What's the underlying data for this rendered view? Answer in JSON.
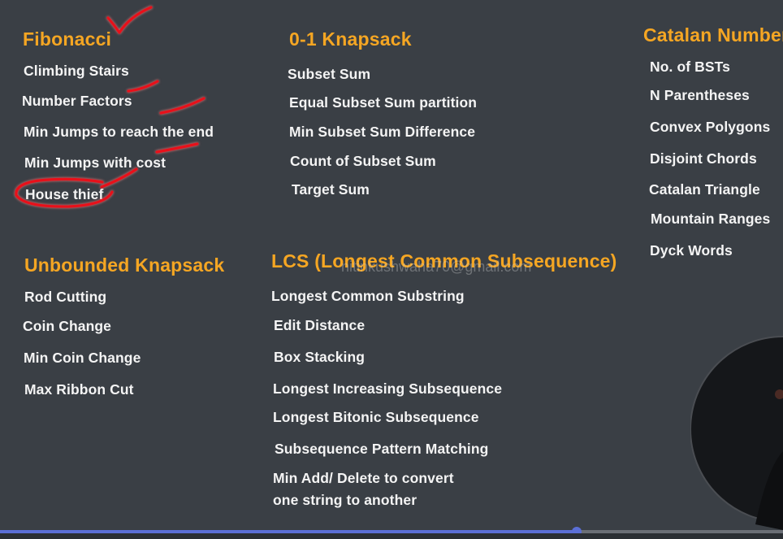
{
  "colors": {
    "heading": "#f5a623",
    "text": "#f4f4f4",
    "background": "#3a3f45",
    "ink": "#e8101a",
    "progress": "#5b6fd6"
  },
  "watermark": "nitinkushwaha70@gmail.com",
  "sections": {
    "fibonacci": {
      "title": "Fibonacci",
      "items": [
        "Climbing Stairs",
        "Number Factors",
        "Min Jumps to reach the end",
        "Min Jumps with cost",
        "House thief"
      ]
    },
    "knapsack01": {
      "title": "0-1 Knapsack",
      "items": [
        "Subset Sum",
        "Equal Subset Sum partition",
        "Min Subset Sum Difference",
        "Count of Subset Sum",
        "Target Sum"
      ]
    },
    "catalan": {
      "title": "Catalan Number",
      "items": [
        "No. of BSTs",
        "N Parentheses",
        "Convex Polygons",
        "Disjoint Chords",
        "Catalan Triangle",
        "Mountain Ranges",
        "Dyck Words"
      ]
    },
    "unbounded": {
      "title": "Unbounded Knapsack",
      "items": [
        "Rod Cutting",
        "Coin Change",
        "Min Coin Change",
        "Max Ribbon Cut"
      ]
    },
    "lcs": {
      "title": "LCS (Longest Common Subsequence)",
      "items": [
        "Longest Common Substring",
        "Edit Distance",
        "Box Stacking",
        "Longest Increasing Subsequence",
        "Longest Bitonic Subsequence",
        "Subsequence Pattern Matching",
        "Min Add/ Delete to convert",
        "one string to another"
      ]
    }
  },
  "player": {
    "progress": 0.736
  }
}
